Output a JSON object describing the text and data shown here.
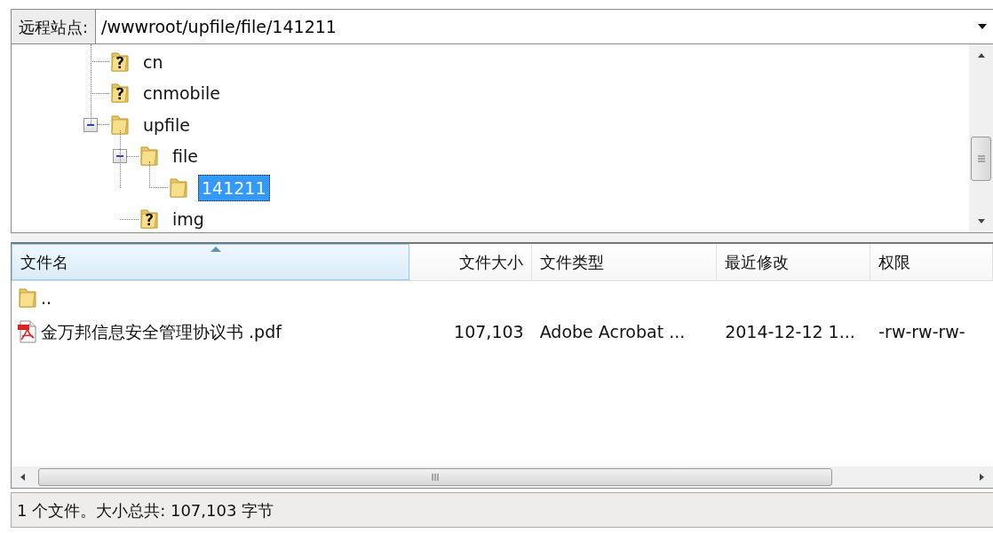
{
  "site_bar": {
    "label": "远程站点:",
    "path": "/wwwroot/upfile/file/141211"
  },
  "tree": [
    {
      "label": "cn",
      "kind": "unknown",
      "selected": false
    },
    {
      "label": "cnmobile",
      "kind": "unknown",
      "selected": false
    },
    {
      "label": "upfile",
      "kind": "folder",
      "selected": false,
      "expanded": true,
      "children": [
        {
          "label": "file",
          "kind": "folder",
          "selected": false,
          "expanded": true,
          "children": [
            {
              "label": "141211",
              "kind": "folder",
              "selected": true
            }
          ]
        },
        {
          "label": "img",
          "kind": "unknown",
          "selected": false
        }
      ]
    }
  ],
  "file_list": {
    "columns": [
      {
        "label": "文件名",
        "sorted": true
      },
      {
        "label": "文件大小",
        "sorted": false
      },
      {
        "label": "文件类型",
        "sorted": false
      },
      {
        "label": "最近修改",
        "sorted": false
      },
      {
        "label": "权限",
        "sorted": false
      }
    ],
    "rows": [
      {
        "kind": "folder",
        "name": ".."
      },
      {
        "kind": "pdf",
        "name": "金万邦信息安全管理协议书 .pdf",
        "size": "107,103",
        "type": "Adobe Acrobat ...",
        "modified": "2014-12-12 1...",
        "permissions": "-rw-rw-rw-"
      }
    ]
  },
  "status_bar": "1 个文件。大小总共: 107,103 字节"
}
